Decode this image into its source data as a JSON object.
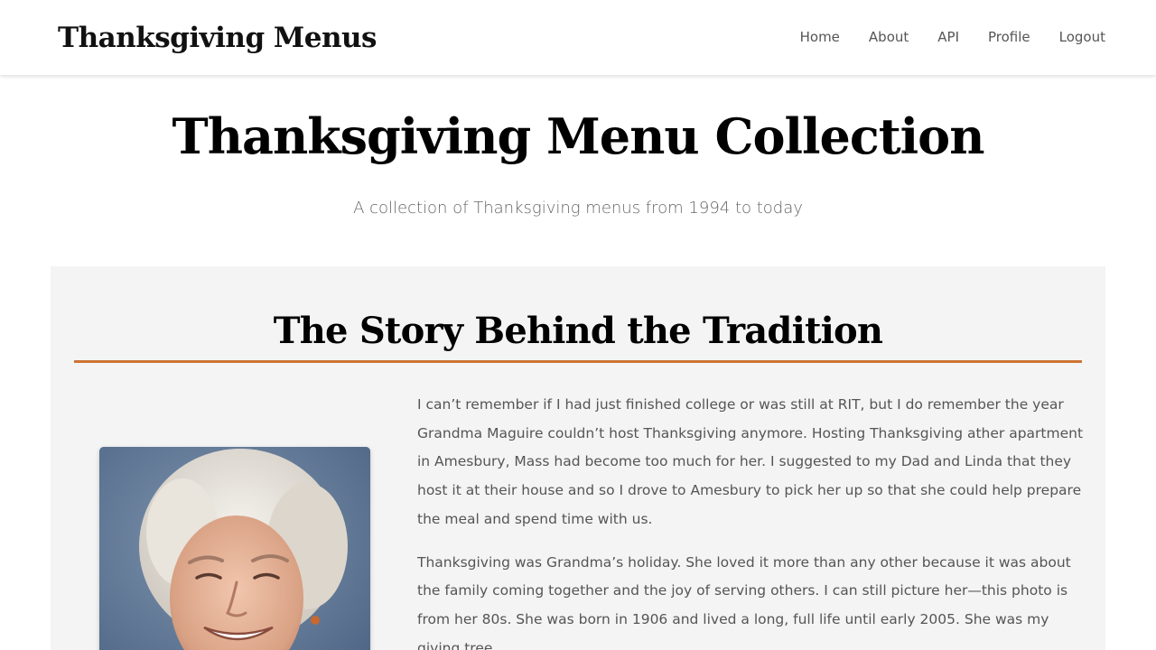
{
  "navbar": {
    "brand": "Thanksgiving Menus",
    "links": [
      {
        "label": "Home"
      },
      {
        "label": "About"
      },
      {
        "label": "API"
      },
      {
        "label": "Profile"
      },
      {
        "label": "Logout"
      }
    ]
  },
  "hero": {
    "title": "Thanksgiving Menu Collection",
    "subtitle": "A collection of Thanksgiving menus from 1994 to today"
  },
  "story": {
    "heading": "The Story Behind the Tradition",
    "paragraphs": [
      "I can’t remember if I had just finished college or was still at RIT, but I do remember the year Grandma Maguire couldn’t host Thanksgiving anymore. Hosting Thanksgiving ather apartment in Amesbury, Mass had become too much for her. I suggested to my Dad and Linda that they host it at their house and so I drove to Amesbury to pick her up so that she could help prepare the meal and spend time with us.",
      "Thanksgiving was Grandma’s holiday. She loved it more than any other because it was about the family coming together and the joy of serving others. I can still picture her—this photo is from her 80s. She was born in 1906 and lived a long, full life until early 2005. She was my giving tree."
    ]
  },
  "colors": {
    "accent_rule": "#cc7434",
    "panel_background": "#f4f4f4",
    "photo_background": "#5a7393"
  }
}
